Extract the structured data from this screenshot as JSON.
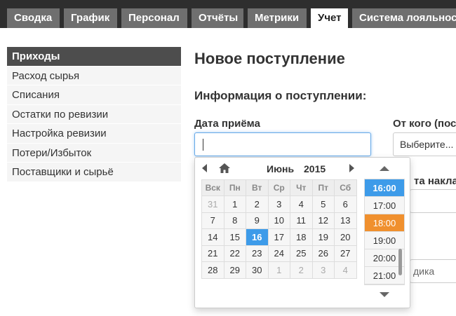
{
  "topnav": {
    "tabs": [
      {
        "label": "Сводка",
        "active": false
      },
      {
        "label": "График",
        "active": false
      },
      {
        "label": "Персонал",
        "active": false
      },
      {
        "label": "Отчёты",
        "active": false
      },
      {
        "label": "Метрики",
        "active": false
      },
      {
        "label": "Учет",
        "active": true
      },
      {
        "label": "Система лояльности",
        "active": false
      }
    ]
  },
  "sidebar": {
    "items": [
      {
        "label": "Приходы",
        "active": true
      },
      {
        "label": "Расход сырья",
        "active": false
      },
      {
        "label": "Списания",
        "active": false
      },
      {
        "label": "Остатки по ревизии",
        "active": false
      },
      {
        "label": "Настройка ревизии",
        "active": false
      },
      {
        "label": "Потери/Избыток",
        "active": false
      },
      {
        "label": "Поставщики и сырьё",
        "active": false
      }
    ]
  },
  "main": {
    "page_title": "Новое поступление",
    "section_title": "Информация о поступлении:",
    "date_label": "Дата приёма",
    "date_value": "",
    "from_label": "От кого (пос",
    "from_select_value": "Выберите...",
    "invoice_label_partial": "та наклад",
    "supplier_placeholder_partial": "дика"
  },
  "datepicker": {
    "month": "Июнь",
    "year": "2015",
    "weekdays": [
      "Вск",
      "Пн",
      "Вт",
      "Ср",
      "Чт",
      "Пт",
      "Сб"
    ],
    "weeks": [
      [
        {
          "d": "31",
          "muted": true
        },
        {
          "d": "1"
        },
        {
          "d": "2"
        },
        {
          "d": "3"
        },
        {
          "d": "4"
        },
        {
          "d": "5"
        },
        {
          "d": "6"
        }
      ],
      [
        {
          "d": "7"
        },
        {
          "d": "8"
        },
        {
          "d": "9"
        },
        {
          "d": "10"
        },
        {
          "d": "11"
        },
        {
          "d": "12"
        },
        {
          "d": "13"
        }
      ],
      [
        {
          "d": "14"
        },
        {
          "d": "15"
        },
        {
          "d": "16",
          "today": true
        },
        {
          "d": "17"
        },
        {
          "d": "18"
        },
        {
          "d": "19"
        },
        {
          "d": "20"
        }
      ],
      [
        {
          "d": "21"
        },
        {
          "d": "22"
        },
        {
          "d": "23"
        },
        {
          "d": "24"
        },
        {
          "d": "25"
        },
        {
          "d": "26"
        },
        {
          "d": "27"
        }
      ],
      [
        {
          "d": "28"
        },
        {
          "d": "29"
        },
        {
          "d": "30"
        },
        {
          "d": "1",
          "muted": true
        },
        {
          "d": "2",
          "muted": true
        },
        {
          "d": "3",
          "muted": true
        },
        {
          "d": "4",
          "muted": true
        }
      ]
    ],
    "times": [
      {
        "t": "16:00",
        "selected": true
      },
      {
        "t": "17:00"
      },
      {
        "t": "18:00",
        "current": true
      },
      {
        "t": "19:00"
      },
      {
        "t": "20:00"
      },
      {
        "t": "21:00"
      }
    ],
    "colors": {
      "selected": "#3d9be9",
      "current": "#f0902e"
    }
  }
}
